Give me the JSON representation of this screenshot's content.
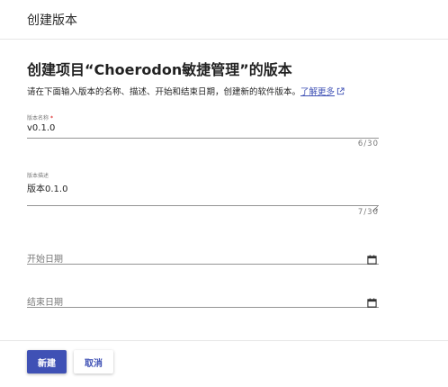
{
  "header": {
    "title": "创建版本"
  },
  "section": {
    "title": "创建项目“Choerodon敏捷管理”的版本",
    "description": "请在下面输入版本的名称、描述、开始和结束日期，创建新的软件版本。",
    "learn_more_link": "了解更多"
  },
  "form": {
    "name": {
      "label": "版本名称",
      "required_mark": "*",
      "value": "v0.1.0",
      "counter": "6/30"
    },
    "description": {
      "label": "版本描述",
      "value": "版本0.1.0",
      "counter": "7/30"
    },
    "start_date": {
      "placeholder": "开始日期"
    },
    "end_date": {
      "placeholder": "结束日期"
    }
  },
  "footer": {
    "create_label": "新建",
    "cancel_label": "取消"
  },
  "colors": {
    "primary": "#3f51b5",
    "required": "#d50000",
    "divider": "#e6e6e6"
  },
  "icons": {
    "external_link": "external-link-icon",
    "calendar": "calendar-icon",
    "resize": "resize-handle-icon"
  }
}
